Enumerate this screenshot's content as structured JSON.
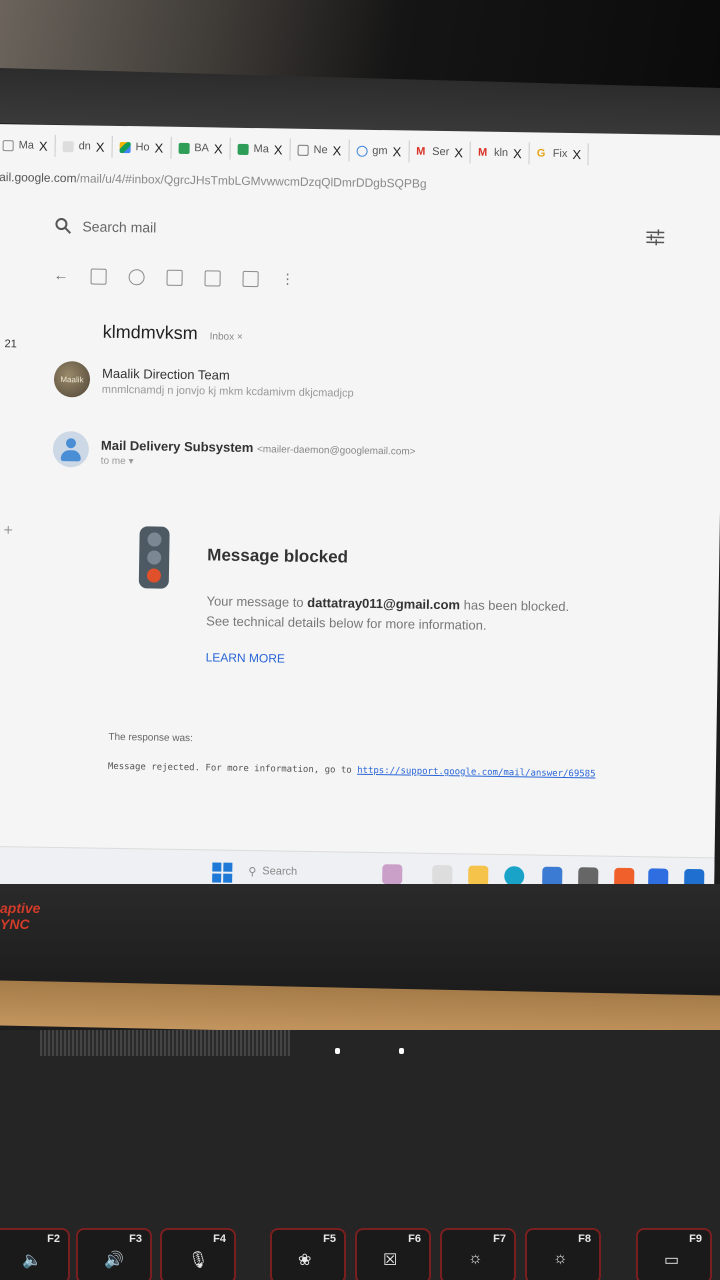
{
  "browser": {
    "tabs": [
      {
        "label": "Ma",
        "icon": "mail-icon",
        "color": "#888888"
      },
      {
        "label": "dn",
        "icon": "page-icon",
        "color": "#aaaaaa"
      },
      {
        "label": "Ho",
        "icon": "drive-icon",
        "color": "#3f86e0"
      },
      {
        "label": "BA",
        "icon": "sheets-icon",
        "color": "#2e9d57"
      },
      {
        "label": "Ma",
        "icon": "sheets-icon",
        "color": "#2e9d57"
      },
      {
        "label": "Ne",
        "icon": "calendar-icon",
        "color": "#777777"
      },
      {
        "label": "gm",
        "icon": "search-icon",
        "color": "#3f86e0"
      },
      {
        "label": "Ser",
        "icon": "gmail-icon",
        "color": "#d93025"
      },
      {
        "label": "kln",
        "icon": "gmail-icon",
        "color": "#d93025"
      },
      {
        "label": "Fix",
        "icon": "google-icon",
        "color": "#e8a317"
      }
    ],
    "close_glyph": "X",
    "url_host": "ail.google.com",
    "url_path": "/mail/u/4/#inbox/QgrcJHsTmbLGMvwwcmDzqQlDmrDDgbSQPBg"
  },
  "gmail": {
    "search_placeholder": "Search mail",
    "left_count": "21",
    "plus": "+",
    "subject": "klmdmvksm",
    "inbox_label": "Inbox ×",
    "messages": [
      {
        "sender": "Maalik Direction Team",
        "snippet": "mnmlcnamdj n jonvjo kj mkm kcdamivm dkjcmadjcp",
        "avatar_text": "Maalik"
      },
      {
        "sender": "Mail Delivery Subsystem",
        "email": "<mailer-daemon@googlemail.com>",
        "to": "to me ▾"
      }
    ],
    "blocked": {
      "title": "Message blocked",
      "line1_pre": "Your message to ",
      "line1_email": "dattatray011@gmail.com",
      "line1_post": " has been blocked.",
      "line2": "See technical details below for more information.",
      "learn_more": "LEARN MORE"
    },
    "response_label": "The response was:",
    "response_text": "Message rejected. For more information, go to ",
    "response_link": "https://support.google.com/mail/answer/69585"
  },
  "taskbar": {
    "search_label": "Search"
  },
  "laptop": {
    "brand_line1": "aptive",
    "brand_line2": "YNC",
    "fkeys": [
      {
        "label": "F2",
        "symbol": "🔈"
      },
      {
        "label": "F3",
        "symbol": "🔊"
      },
      {
        "label": "F4",
        "symbol": "🎙"
      },
      {
        "label": "F5",
        "symbol": "❀"
      },
      {
        "label": "F6",
        "symbol": "☒"
      },
      {
        "label": "F7",
        "symbol": "☼"
      },
      {
        "label": "F8",
        "symbol": "☼"
      },
      {
        "label": "F9",
        "symbol": "▭"
      }
    ]
  },
  "colors": {
    "accent": "#2b66d8",
    "signal_red": "#e0502a",
    "brand_red": "#d13b2a"
  }
}
